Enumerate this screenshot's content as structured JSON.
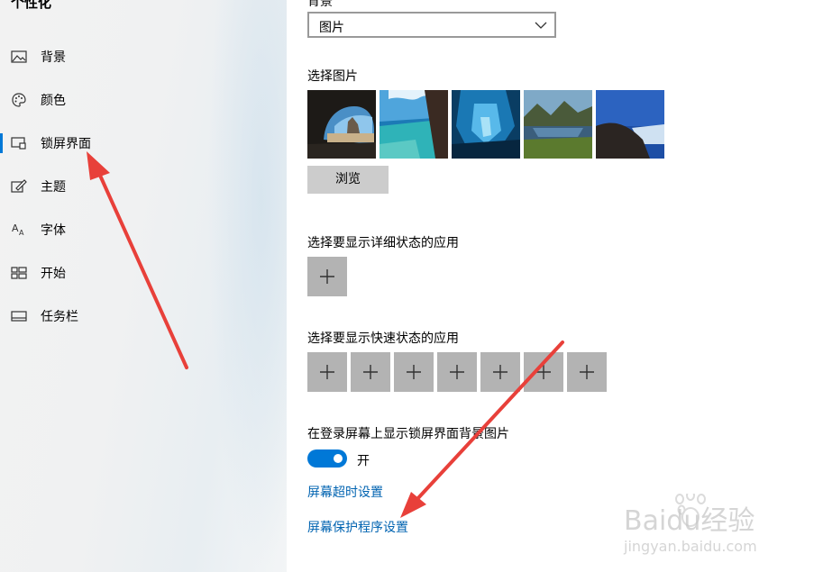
{
  "sidebar": {
    "title": "个性化",
    "items": [
      {
        "label": "背景",
        "icon": "picture-icon",
        "active": false
      },
      {
        "label": "颜色",
        "icon": "palette-icon",
        "active": false
      },
      {
        "label": "锁屏界面",
        "icon": "lock-screen-icon",
        "active": true
      },
      {
        "label": "主题",
        "icon": "theme-icon",
        "active": false
      },
      {
        "label": "字体",
        "icon": "font-icon",
        "active": false
      },
      {
        "label": "开始",
        "icon": "start-icon",
        "active": false
      },
      {
        "label": "任务栏",
        "icon": "taskbar-icon",
        "active": false
      }
    ]
  },
  "main": {
    "background_label": "背景",
    "background_dropdown_value": "图片",
    "choose_picture_label": "选择图片",
    "browse_label": "浏览",
    "detailed_status_label": "选择要显示详细状态的应用",
    "quick_status_label": "选择要显示快速状态的应用",
    "show_bg_on_signin_label": "在登录屏幕上显示锁屏界面背景图片",
    "toggle_state": "开",
    "screen_timeout_link": "屏幕超时设置",
    "screensaver_link": "屏幕保护程序设置"
  },
  "watermark": {
    "brand": "Baidu经验",
    "url": "jingyan.baidu.com"
  },
  "colors": {
    "accent": "#0078d7",
    "link": "#0063b1",
    "annotation_arrow": "#e8403a"
  }
}
